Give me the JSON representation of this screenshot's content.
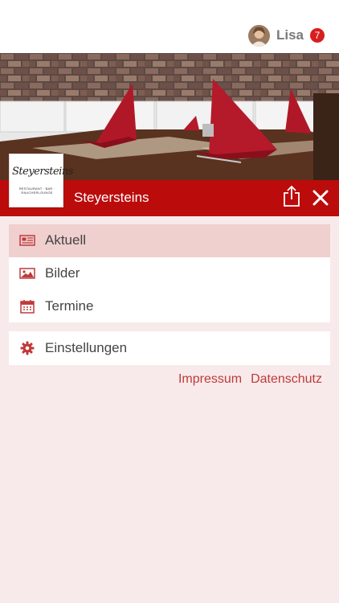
{
  "user": {
    "name": "Lisa",
    "notifications": "7"
  },
  "venue": {
    "name": "Steyersteins",
    "logo_text": "Steyersteins",
    "logo_subtitle": "RESTAURANT · BAR · RAUCHERLOUNGE"
  },
  "menu": [
    {
      "label": "Aktuell",
      "icon": "newspaper-icon",
      "active": true
    },
    {
      "label": "Bilder",
      "icon": "image-icon",
      "active": false
    },
    {
      "label": "Termine",
      "icon": "calendar-icon",
      "active": false
    }
  ],
  "settings": {
    "label": "Einstellungen",
    "icon": "gear-icon"
  },
  "footer_links": {
    "impressum": "Impressum",
    "datenschutz": "Datenschutz"
  },
  "colors": {
    "accent": "#bb0b0b",
    "background": "#f8eaea",
    "active_item": "#f0cfcf",
    "icon": "#c03a3a"
  }
}
